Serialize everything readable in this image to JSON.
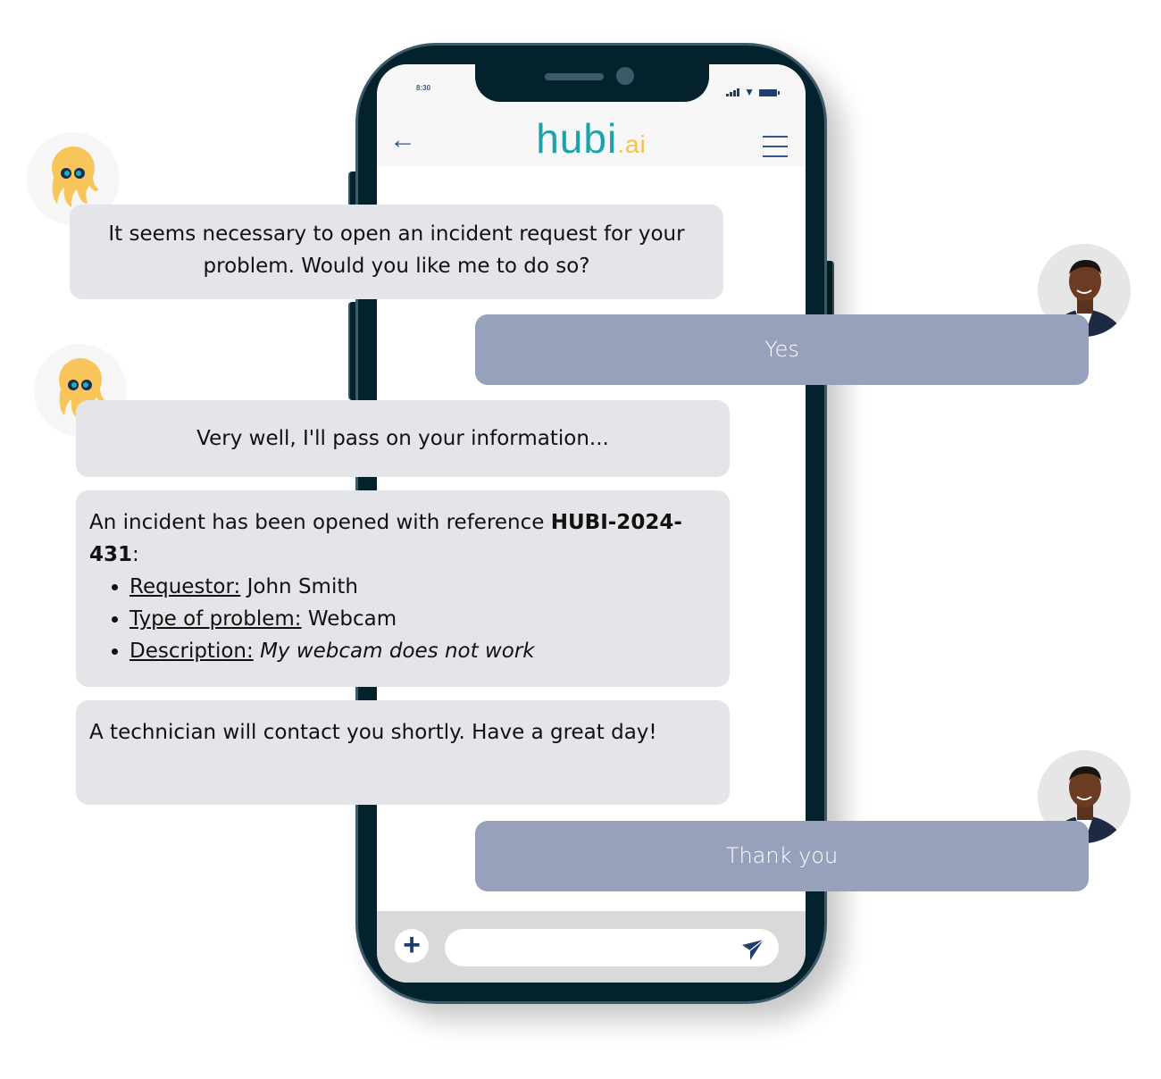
{
  "phone": {
    "status_time": "8:30",
    "header": {
      "logo_main": "hubi",
      "logo_suffix": ".ai",
      "back_icon": "arrow-left-icon",
      "menu_icon": "hamburger-menu-icon"
    },
    "composer": {
      "add_icon": "plus-icon",
      "input_value": "",
      "input_placeholder": "",
      "send_icon": "paper-plane-icon"
    }
  },
  "colors": {
    "brand_teal": "#1aa3a8",
    "brand_yellow": "#f6c343",
    "bot_bubble": "#e4e5e9",
    "user_bubble": "#97a1bc",
    "phone_frame": "#03222c",
    "icon_blue": "#1f3d6e"
  },
  "messages": [
    {
      "sender": "bot",
      "avatar": "octopus-icon",
      "text": "It seems necessary to open an incident request for your problem. Would you like me to do so?"
    },
    {
      "sender": "user",
      "avatar": "user-photo",
      "text": "Yes"
    },
    {
      "sender": "bot",
      "avatar": "octopus-icon",
      "text": "Very well, I'll pass on your information..."
    },
    {
      "sender": "bot",
      "intro": "An incident has been opened with reference ",
      "reference": "HUBI-2024-431",
      "intro_suffix": ":",
      "fields": [
        {
          "label": "Requestor:",
          "value": "John Smith",
          "italic": false
        },
        {
          "label": "Type of problem:",
          "value": "Webcam",
          "italic": false
        },
        {
          "label": "Description:",
          "value": "My webcam does not work",
          "italic": true
        }
      ]
    },
    {
      "sender": "bot",
      "text": "A technician will contact you shortly. Have a great day!"
    },
    {
      "sender": "user",
      "avatar": "user-photo",
      "text": "Thank you"
    }
  ]
}
